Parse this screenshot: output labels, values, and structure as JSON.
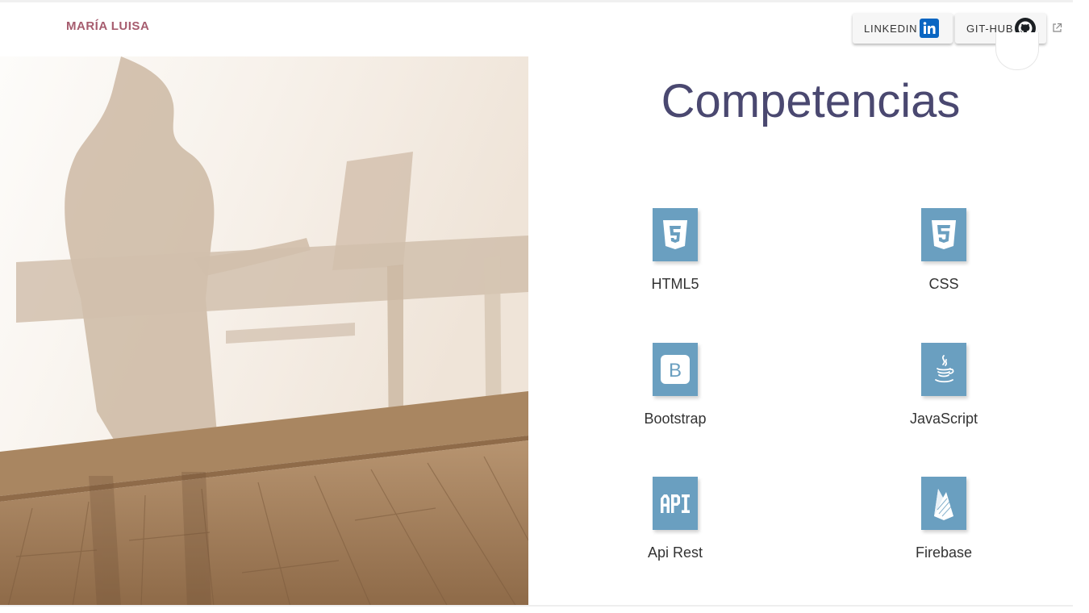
{
  "header": {
    "brand": "MARÍA LUISA",
    "buttons": [
      {
        "label": "LINKEDIN",
        "icon": "linkedin-icon"
      },
      {
        "label": "GIT-HUB",
        "icon": "github-icon"
      }
    ],
    "external_icon": "external-link-icon"
  },
  "main": {
    "heading": "Competencias",
    "skills": [
      {
        "name": "HTML5",
        "icon": "html5-icon"
      },
      {
        "name": "CSS",
        "icon": "css3-icon"
      },
      {
        "name": "Bootstrap",
        "icon": "bootstrap-icon"
      },
      {
        "name": "JavaScript",
        "icon": "java-coffee-icon"
      },
      {
        "name": "Api Rest",
        "icon": "api-icon"
      },
      {
        "name": "Firebase",
        "icon": "firebase-icon"
      }
    ]
  },
  "colors": {
    "brand": "#a65c6e",
    "heading": "#4a4870",
    "tile": "#6a9fc0",
    "linkedin": "#0a66c2"
  }
}
